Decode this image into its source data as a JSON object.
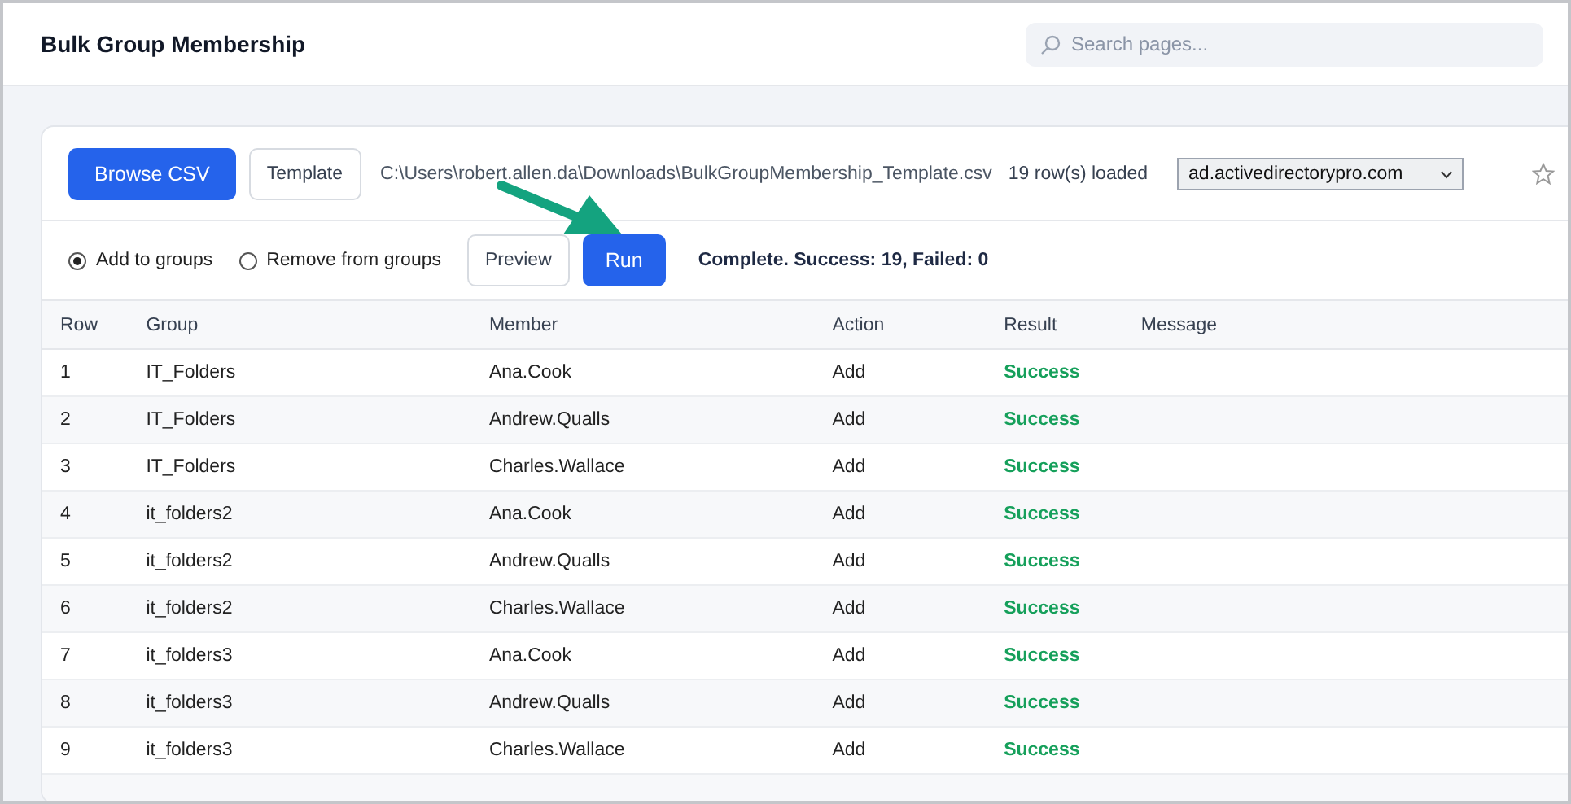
{
  "window": {
    "title": "Bulk Group Membership"
  },
  "search": {
    "placeholder": "Search pages..."
  },
  "file_bar": {
    "browse_button": "Browse CSV",
    "template_button": "Template",
    "file_path": "C:\\Users\\robert.allen.da\\Downloads\\BulkGroupMembership_Template.csv",
    "row_count": "19 row(s) loaded",
    "domain": "ad.activedirectorypro.com"
  },
  "action_bar": {
    "modes": [
      {
        "label": "Add to groups",
        "selected": true
      },
      {
        "label": "Remove from groups",
        "selected": false
      }
    ],
    "preview_button": "Preview",
    "run_button": "Run",
    "status": "Complete. Success: 19, Failed: 0"
  },
  "table": {
    "columns": [
      "Row",
      "Group",
      "Member",
      "Action",
      "Result",
      "Message"
    ],
    "rows": [
      {
        "row": "1",
        "group": "IT_Folders",
        "member": "Ana.Cook",
        "action": "Add",
        "result": "Success",
        "message": ""
      },
      {
        "row": "2",
        "group": "IT_Folders",
        "member": "Andrew.Qualls",
        "action": "Add",
        "result": "Success",
        "message": ""
      },
      {
        "row": "3",
        "group": "IT_Folders",
        "member": "Charles.Wallace",
        "action": "Add",
        "result": "Success",
        "message": ""
      },
      {
        "row": "4",
        "group": "it_folders2",
        "member": "Ana.Cook",
        "action": "Add",
        "result": "Success",
        "message": ""
      },
      {
        "row": "5",
        "group": "it_folders2",
        "member": "Andrew.Qualls",
        "action": "Add",
        "result": "Success",
        "message": ""
      },
      {
        "row": "6",
        "group": "it_folders2",
        "member": "Charles.Wallace",
        "action": "Add",
        "result": "Success",
        "message": ""
      },
      {
        "row": "7",
        "group": "it_folders3",
        "member": "Ana.Cook",
        "action": "Add",
        "result": "Success",
        "message": ""
      },
      {
        "row": "8",
        "group": "it_folders3",
        "member": "Andrew.Qualls",
        "action": "Add",
        "result": "Success",
        "message": ""
      },
      {
        "row": "9",
        "group": "it_folders3",
        "member": "Charles.Wallace",
        "action": "Add",
        "result": "Success",
        "message": ""
      }
    ]
  }
}
